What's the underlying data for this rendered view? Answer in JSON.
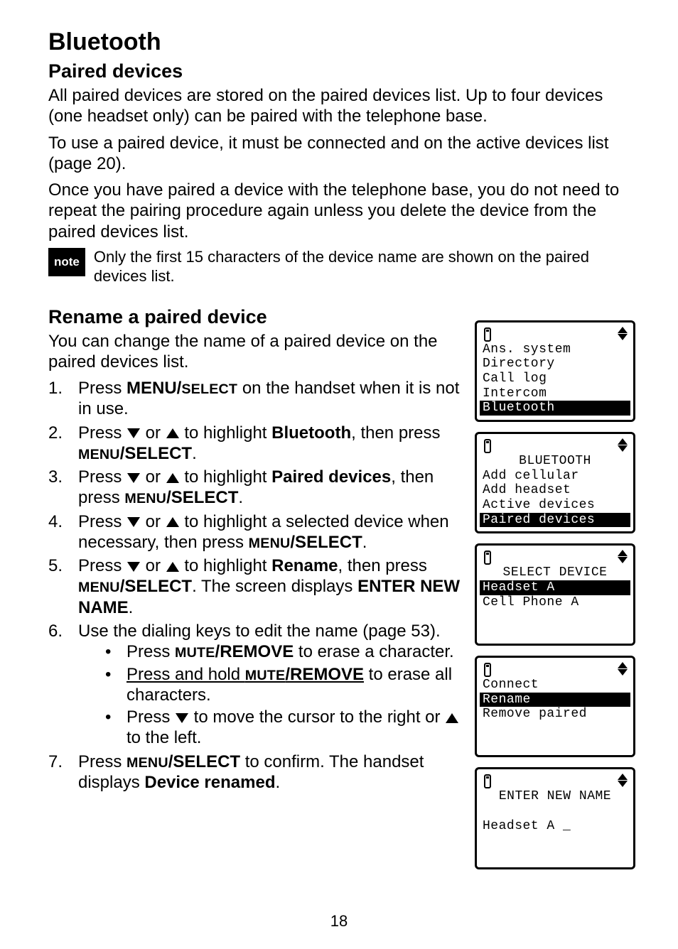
{
  "page": {
    "title": "Bluetooth",
    "section1_heading": "Paired devices",
    "section1_p1": "All paired devices are stored on the paired devices list. Up to four devices (one headset only) can be paired with the telephone base.",
    "section1_p2": "To use a paired device, it must be connected and on the active devices list (page 20).",
    "section1_p3": "Once you have paired a device with the telephone base, you do not need to repeat the pairing procedure again unless you delete the device from the paired devices list.",
    "note_badge": "note",
    "note_text": "Only the first 15 characters of the device name are shown on the paired devices list.",
    "section2_heading": "Rename a paired device",
    "section2_p1": "You can change the name of a paired device on the paired devices list.",
    "steps": {
      "s1_a": "Press ",
      "s1_b": "MENU/",
      "s1_c": "SELECT",
      "s1_d": " on the handset when it is not in use.",
      "s2_a": "Press ",
      "s2_b": " or ",
      "s2_c": " to highlight ",
      "s2_d": "Bluetooth",
      "s2_e": ", then press ",
      "s2_f": "MENU",
      "s2_g": "/SELECT",
      "s2_h": ".",
      "s3_a": "Press ",
      "s3_b": " or ",
      "s3_c": " to highlight ",
      "s3_d": "Paired devices",
      "s3_e": ", then press ",
      "s3_f": "MENU",
      "s3_g": "/SELECT",
      "s3_h": ".",
      "s4_a": "Press ",
      "s4_b": " or ",
      "s4_c": " to highlight a selected device when necessary, then press ",
      "s4_d": "MENU",
      "s4_e": "/SELECT",
      "s4_f": ".",
      "s5_a": "Press ",
      "s5_b": " or ",
      "s5_c": " to highlight ",
      "s5_d": "Rename",
      "s5_e": ", then press ",
      "s5_f": "MENU",
      "s5_g": "/SELECT",
      "s5_h": ". The screen displays ",
      "s5_i": "ENTER NEW NAME",
      "s5_j": ".",
      "s6_a": "Use the dialing keys to edit the name (page 53).",
      "s6b1_a": "Press ",
      "s6b1_b": "MUTE",
      "s6b1_c": "/REMOVE",
      "s6b1_d": " to erase a character.",
      "s6b2_a": "Press and hold ",
      "s6b2_b": "MUTE",
      "s6b2_c": "/REMOVE",
      "s6b2_d": " to erase all characters.",
      "s6b3_a": "Press ",
      "s6b3_b": " to move the cursor to the right or ",
      "s6b3_c": " to the left.",
      "s7_a": "Press ",
      "s7_b": "MENU",
      "s7_c": "/SELECT",
      "s7_d": " to confirm. The handset displays ",
      "s7_e": "Device renamed",
      "s7_f": "."
    },
    "page_number": "18"
  },
  "lcd": {
    "screen1": {
      "l1": "Ans. system",
      "l2": "Directory",
      "l3": "Call log",
      "l4": "Intercom",
      "l5": "Bluetooth"
    },
    "screen2": {
      "title": "BLUETOOTH",
      "l1": "Add cellular",
      "l2": "Add headset",
      "l3": "Active devices",
      "l4": "Paired devices"
    },
    "screen3": {
      "title": "SELECT DEVICE",
      "l1": "Headset A",
      "l2": "Cell Phone A"
    },
    "screen4": {
      "l1": "Connect",
      "l2": "Rename",
      "l3": "Remove paired"
    },
    "screen5": {
      "title": "ENTER NEW NAME",
      "value": "Headset A _"
    }
  }
}
